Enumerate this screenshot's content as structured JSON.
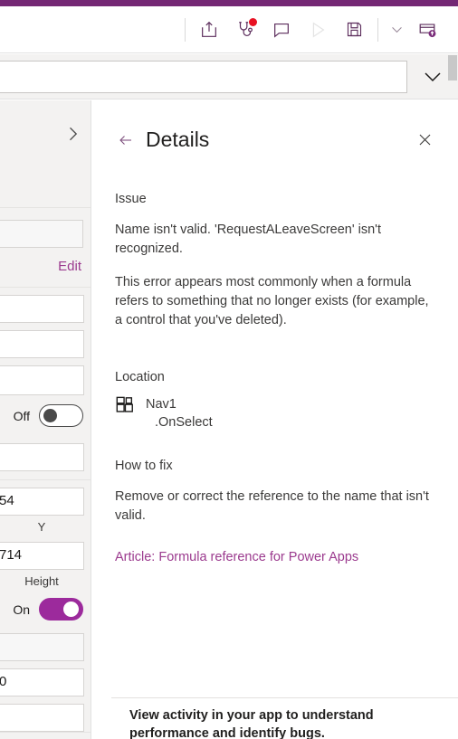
{
  "theme": {
    "brand_purple": "#742774",
    "accent_purple": "#9c2a9c",
    "link_purple": "#9b3a8e",
    "badge_red": "#e81123",
    "panel_gray": "#f3f2f1"
  },
  "toolbar": {
    "share_label": "Share",
    "app_checker_label": "App checker",
    "comments_label": "Comments",
    "preview_label": "Preview the app",
    "save_label": "Save",
    "save_menu_label": "Save options",
    "publish_label": "Publish",
    "badge_visible": true
  },
  "formula_bar": {
    "value": "",
    "placeholder": "",
    "expand_label": "Expand formula bar"
  },
  "properties_pane": {
    "expand_label": "Expand",
    "dropdown_value": "",
    "edit_label": "Edit",
    "fields": [
      {
        "name": "field-1",
        "value": ""
      },
      {
        "name": "field-2",
        "value": ""
      },
      {
        "name": "field-3",
        "value": ""
      }
    ],
    "toggle_off": {
      "label": "Off",
      "state": "off"
    },
    "field_after_toggle": {
      "value": ""
    },
    "x_value": "54",
    "y_label": "Y",
    "y_value": "714",
    "height_label": "Height",
    "toggle_on": {
      "label": "On",
      "state": "on"
    },
    "select_value": "",
    "last_value": "0"
  },
  "details": {
    "back_label": "Back",
    "title": "Details",
    "close_label": "Close",
    "issue_heading": "Issue",
    "issue_text": "Name isn't valid. 'RequestALeaveScreen' isn't recognized.",
    "issue_explanation": "This error appears most commonly when a formula refers to something that no longer exists (for example, a control that you've deleted).",
    "location_heading": "Location",
    "location_control": "Nav1",
    "location_property": ".OnSelect",
    "fix_heading": "How to fix",
    "fix_text": "Remove or correct the reference to the name that isn't valid.",
    "article_link": "Article: Formula reference for Power Apps"
  },
  "footer": {
    "text": "View activity in your app to understand performance and identify bugs."
  }
}
